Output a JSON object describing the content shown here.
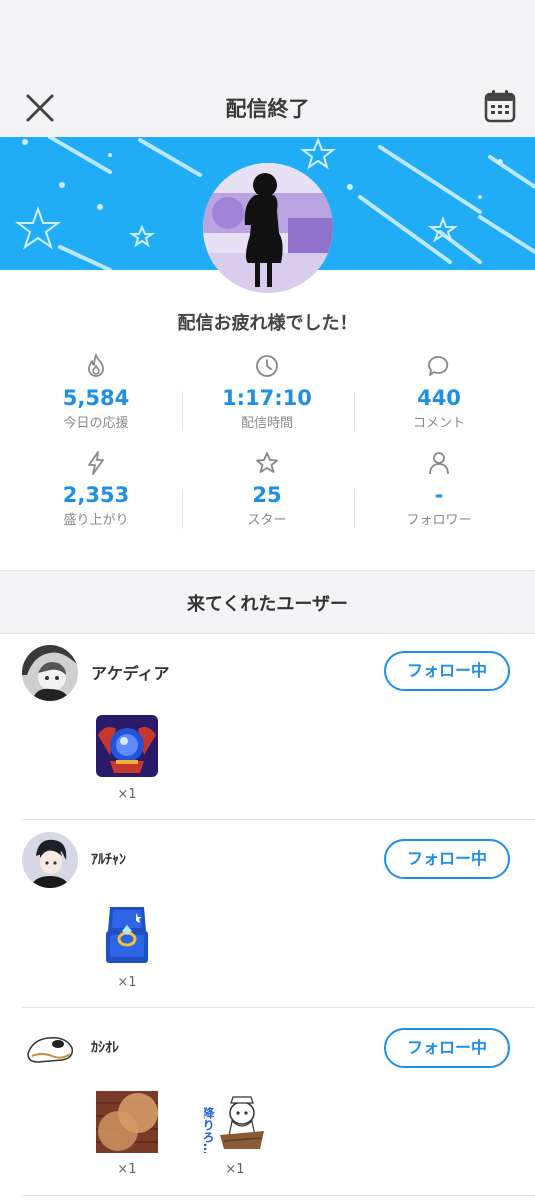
{
  "header": {
    "title": "配信終了",
    "close_icon": "close-icon",
    "calendar_icon": "calendar-icon"
  },
  "banner": {
    "color": "#20adf6"
  },
  "thanks_message": "配信お疲れ様でした！",
  "stats": [
    {
      "icon": "flame-icon",
      "value": "5,584",
      "label": "今日の応援"
    },
    {
      "icon": "clock-icon",
      "value": "1:17:10",
      "label": "配信時間"
    },
    {
      "icon": "comment-icon",
      "value": "440",
      "label": "コメント"
    },
    {
      "icon": "lightning-icon",
      "value": "2,353",
      "label": "盛り上がり"
    },
    {
      "icon": "star-icon",
      "value": "25",
      "label": "スター"
    },
    {
      "icon": "person-icon",
      "value": "-",
      "label": "フォロワー"
    }
  ],
  "section_title": "来てくれたユーザー",
  "accent_color": "#1d8fe6",
  "users": [
    {
      "name": "アケディア",
      "follow_label": "フォロー中",
      "gifts": [
        {
          "icon": "crystal-ball-gift-icon",
          "qty": "×1"
        }
      ]
    },
    {
      "name": "ｱﾙﾁｬﾝ",
      "follow_label": "フォロー中",
      "gifts": [
        {
          "icon": "ring-box-gift-icon",
          "qty": "×1"
        }
      ]
    },
    {
      "name": "ｶｼｵﾚ",
      "follow_label": "フォロー中",
      "gifts": [
        {
          "icon": "brick-wall-gift-icon",
          "qty": "×1"
        },
        {
          "icon": "cat-boat-sticker-icon",
          "qty": "×1",
          "text": "降りろ…"
        }
      ]
    }
  ]
}
